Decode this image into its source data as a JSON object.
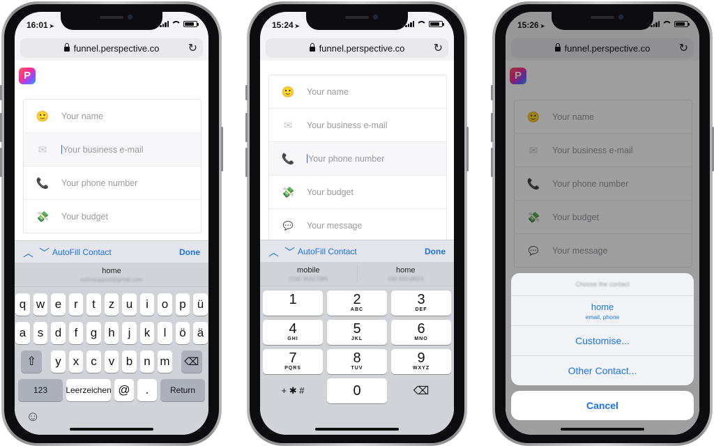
{
  "shared": {
    "url": "funnel.perspective.co",
    "logo_letter": "P",
    "fields": {
      "name": "Your name",
      "email": "Your business e-mail",
      "phone": "Your phone number",
      "budget": "Your budget",
      "message": "Your message"
    },
    "icons": {
      "name": "🙂",
      "email": "✉",
      "phone": "📞",
      "budget": "💸",
      "message": "💬"
    },
    "autofill_label": "AutoFill Contact",
    "done_label": "Done",
    "arrows": {
      "up": "︿",
      "down": "﹀"
    }
  },
  "phone1": {
    "time": "16:01",
    "suggestion": {
      "label": "home",
      "value": "echosupport@gmail.com"
    },
    "keys_row1": [
      "q",
      "w",
      "e",
      "r",
      "t",
      "z",
      "u",
      "i",
      "o",
      "p",
      "ü"
    ],
    "keys_row2": [
      "a",
      "s",
      "d",
      "f",
      "g",
      "h",
      "j",
      "k",
      "l",
      "ö",
      "ä"
    ],
    "keys_row3": [
      "y",
      "x",
      "c",
      "v",
      "b",
      "n",
      "m"
    ],
    "key_123": "123",
    "key_space": "Leerzeichen",
    "key_at": "@",
    "key_dot": ".",
    "key_return": "Return",
    "key_shift": "⇧",
    "key_delete": "⌫",
    "key_emoji": "☺"
  },
  "phone2": {
    "time": "15:24",
    "suggestions": [
      {
        "label": "mobile",
        "value": "0160 96417889"
      },
      {
        "label": "home",
        "value": "030 50018023"
      }
    ],
    "numkeys": [
      {
        "d": "1",
        "t": ""
      },
      {
        "d": "2",
        "t": "ABC"
      },
      {
        "d": "3",
        "t": "DEF"
      },
      {
        "d": "4",
        "t": "GHI"
      },
      {
        "d": "5",
        "t": "JKL"
      },
      {
        "d": "6",
        "t": "MNO"
      },
      {
        "d": "7",
        "t": "PQRS"
      },
      {
        "d": "8",
        "t": "TUV"
      },
      {
        "d": "9",
        "t": "WXYZ"
      }
    ],
    "key_symbols": "+ ✱ #",
    "key_zero": "0",
    "key_delete": "⌫"
  },
  "phone3": {
    "time": "15:26",
    "sheet_title": "Choose the contact",
    "option_home": "home",
    "option_home_sub": "email, phone",
    "option_customise": "Customise...",
    "option_other": "Other Contact...",
    "cancel": "Cancel"
  },
  "colors": {
    "accent": "#1a73e8",
    "keyboard_bg": "#d1d3d9"
  }
}
